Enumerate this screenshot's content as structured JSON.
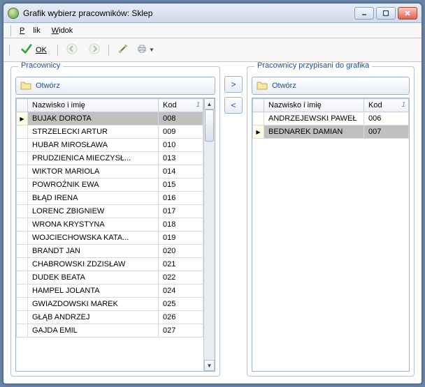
{
  "window": {
    "title": "Grafik wybierz pracowników: Sklep"
  },
  "menu": {
    "file": "Plik",
    "view": "Widok"
  },
  "toolbar": {
    "ok_label": "OK"
  },
  "left": {
    "legend": "Pracownicy",
    "open_label": "Otwórz",
    "columns": {
      "name": "Nazwisko i imię",
      "code": "Kod",
      "sort": "1"
    },
    "rows": [
      {
        "name": "BUJAK DOROTA",
        "code": "008",
        "current": true,
        "selected": true
      },
      {
        "name": "STRZELECKI ARTUR",
        "code": "009"
      },
      {
        "name": "HUBAR MIROSŁAWA",
        "code": "010"
      },
      {
        "name": "PRUDZIENICA MIECZYSŁ...",
        "code": "013"
      },
      {
        "name": "WIKTOR MARIOLA",
        "code": "014"
      },
      {
        "name": "POWROŹNIK EWA",
        "code": "015"
      },
      {
        "name": "BŁĄD IRENA",
        "code": "016"
      },
      {
        "name": "LORENC ZBIGNIEW",
        "code": "017"
      },
      {
        "name": "WRONA KRYSTYNA",
        "code": "018"
      },
      {
        "name": "WOJCIECHOWSKA KATA...",
        "code": "019"
      },
      {
        "name": "BRANDT JAN",
        "code": "020"
      },
      {
        "name": "CHABROWSKI ZDZISŁAW",
        "code": "021"
      },
      {
        "name": "DUDEK BEATA",
        "code": "022"
      },
      {
        "name": "HAMPEL JOLANTA",
        "code": "024"
      },
      {
        "name": "GWIAZDOWSKI MAREK",
        "code": "025"
      },
      {
        "name": "GŁĄB ANDRZEJ",
        "code": "026"
      },
      {
        "name": "GAJDA EMIL",
        "code": "027"
      }
    ]
  },
  "right": {
    "legend": "Pracownicy przypisani do grafika",
    "open_label": "Otwórz",
    "columns": {
      "name": "Nazwisko i imię",
      "code": "Kod",
      "sort": "1"
    },
    "rows": [
      {
        "name": "ANDRZEJEWSKI PAWEŁ",
        "code": "006"
      },
      {
        "name": "BEDNAREK DAMIAN",
        "code": "007",
        "current": true,
        "selected": true
      }
    ]
  },
  "icons": {
    "folder": "folder-icon",
    "check": "check-icon",
    "back": "back-icon",
    "forward": "forward-icon",
    "tools": "tools-icon",
    "print": "print-icon"
  }
}
